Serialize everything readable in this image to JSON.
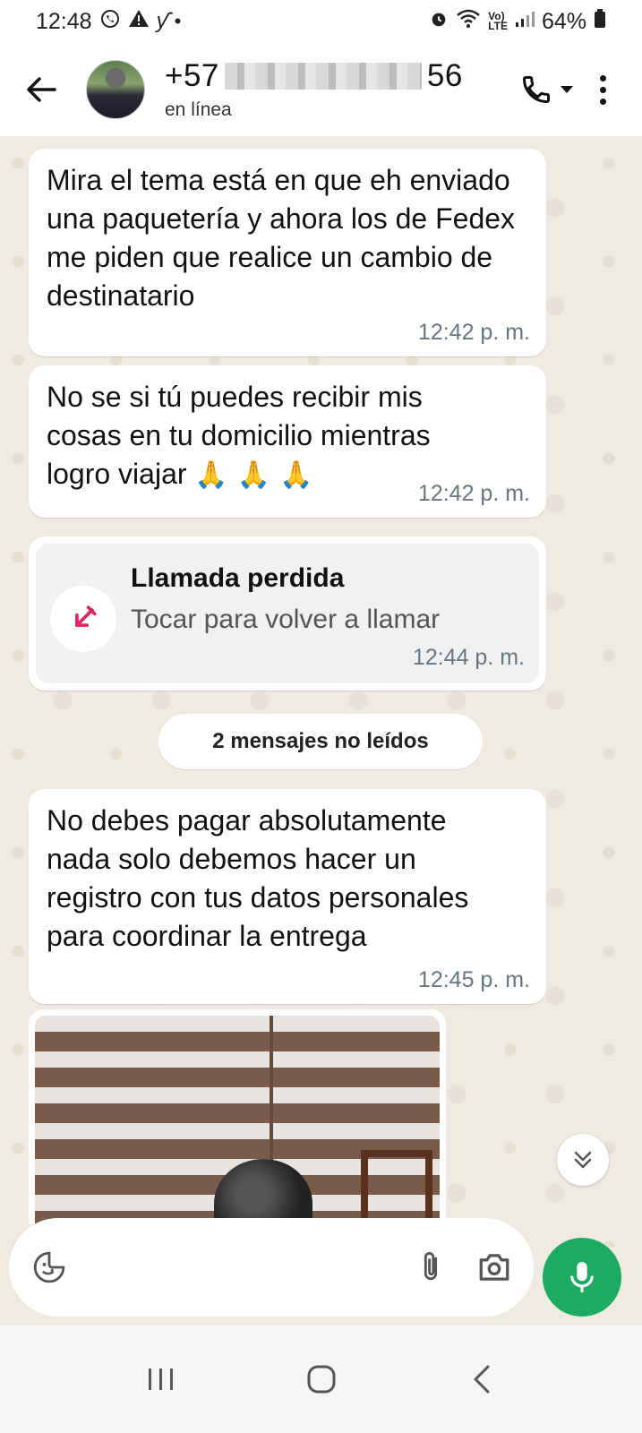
{
  "status_bar": {
    "time": "12:48",
    "battery": "64%"
  },
  "header": {
    "contact_prefix": "+57",
    "contact_suffix": "56",
    "status": "en línea"
  },
  "messages": [
    {
      "text": "Mira el tema está en que eh enviado una paquetería y ahora los de Fedex me piden que realice un cambio de destinatario",
      "time": "12:42 p. m."
    },
    {
      "text": "No se si tú puedes recibir mis cosas en tu domicilio mientras logro viajar",
      "emoji": "🙏🙏🙏",
      "time": "12:42 p. m."
    },
    {
      "text": "No debes pagar absolutamente nada solo debemos hacer un registro con tus datos personales para coordinar la entrega",
      "time": "12:45 p. m."
    }
  ],
  "missed_call": {
    "title": "Llamada perdida",
    "subtitle": "Tocar para volver a llamar",
    "time": "12:44 p. m."
  },
  "unread_label": "2 mensajes no leídos",
  "input": {
    "placeholder": ""
  },
  "colors": {
    "accent": "#1daa61",
    "missed_call_icon": "#e0245e",
    "chat_background": "#efeae2"
  },
  "icons": {
    "back": "arrow-left-icon",
    "call": "phone-icon",
    "menu": "more-vertical-icon",
    "sticker": "sticker-icon",
    "attach": "paperclip-icon",
    "camera": "camera-icon",
    "mic": "microphone-icon"
  }
}
